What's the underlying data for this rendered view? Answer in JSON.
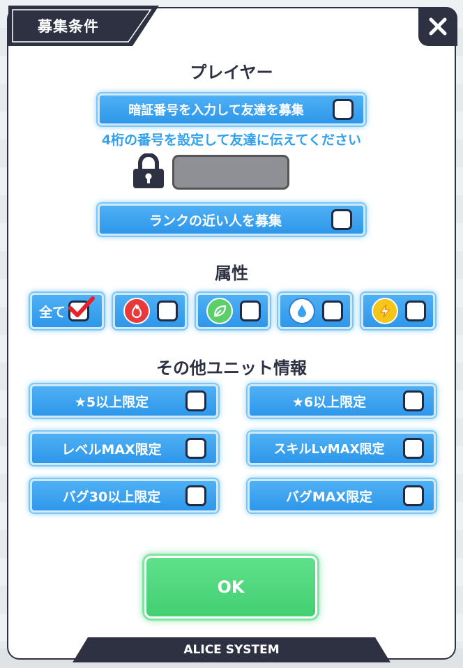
{
  "dialog": {
    "title": "募集条件",
    "footer": "ALICE SYSTEM"
  },
  "player_section": {
    "title": "プレイヤー",
    "pin_option_label": "暗証番号を入力して友達を募集",
    "pin_option_checked": false,
    "pin_hint": "4桁の番号を設定して友達に伝えてください",
    "pin_value": "",
    "rank_option_label": "ランクの近い人を募集",
    "rank_option_checked": false
  },
  "attribute_section": {
    "title": "属性",
    "all_label": "全て",
    "all_checked": true,
    "attributes": [
      {
        "icon": "fire-icon",
        "color": "#e83a3a",
        "checked": false
      },
      {
        "icon": "leaf-icon",
        "color": "#5ccf6a",
        "checked": false
      },
      {
        "icon": "water-drop-icon",
        "color": "#ffffff",
        "checked": false
      },
      {
        "icon": "lightning-icon",
        "color": "#f5c518",
        "checked": false
      }
    ]
  },
  "unit_section": {
    "title": "その他ユニット情報",
    "options": [
      {
        "label": "★5以上限定",
        "checked": false
      },
      {
        "label": "★6以上限定",
        "checked": false
      },
      {
        "label": "レベルMAX限定",
        "checked": false
      },
      {
        "label": "スキルLvMAX限定",
        "checked": false
      },
      {
        "label": "バグ30以上限定",
        "checked": false
      },
      {
        "label": "バグMAX限定",
        "checked": false
      }
    ]
  },
  "ok_label": "OK",
  "colors": {
    "dark_navy": "#2d3142",
    "button_blue": "#3aa3ee",
    "hint_blue": "#2fa0ee",
    "ok_green": "#4fd67c",
    "check_red": "#e8202a"
  }
}
